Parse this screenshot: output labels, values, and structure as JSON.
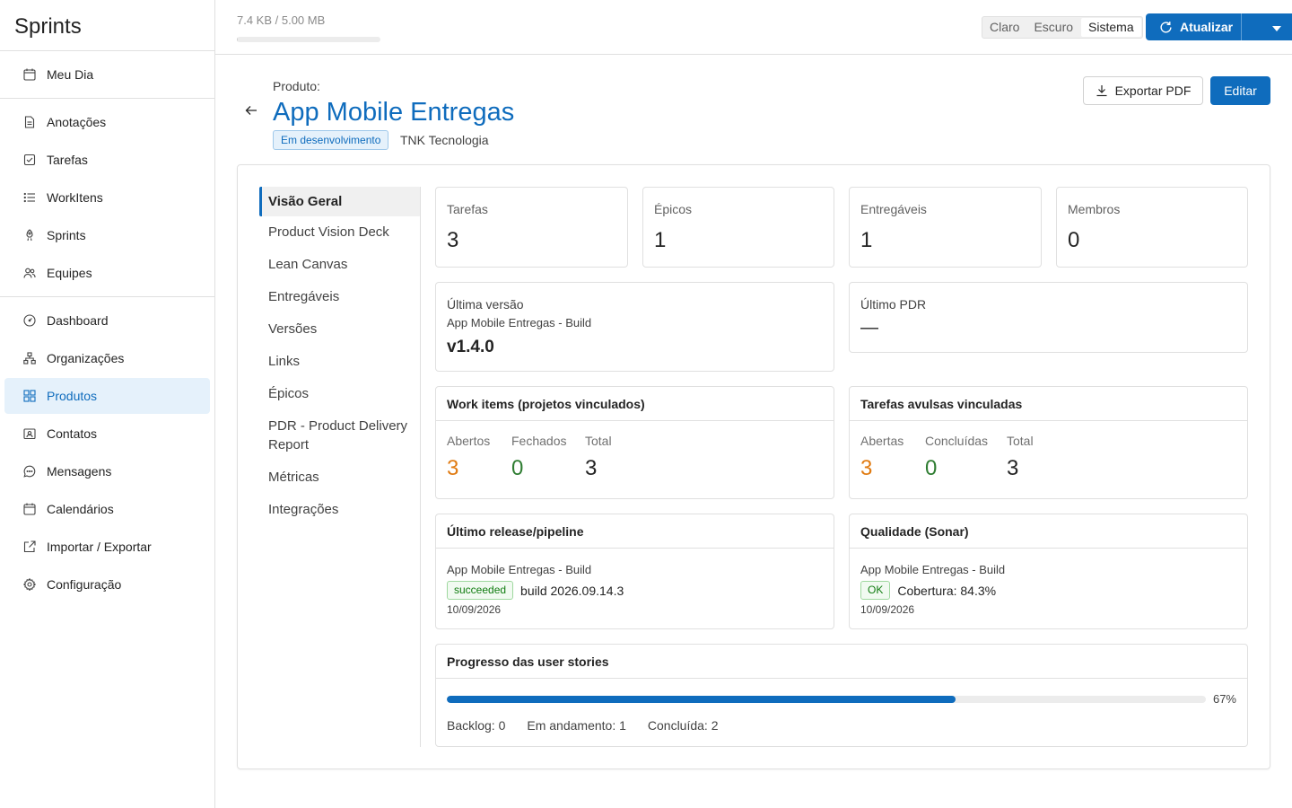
{
  "app": {
    "title": "Sprints"
  },
  "sidebar": {
    "groups": [
      [
        {
          "label": "Meu Dia",
          "icon": "calendar-icon"
        }
      ],
      [
        {
          "label": "Anotações",
          "icon": "note-icon"
        },
        {
          "label": "Tarefas",
          "icon": "checkbox-icon"
        },
        {
          "label": "WorkItens",
          "icon": "list-icon"
        },
        {
          "label": "Sprints",
          "icon": "rocket-icon"
        },
        {
          "label": "Equipes",
          "icon": "people-icon"
        }
      ],
      [
        {
          "label": "Dashboard",
          "icon": "gauge-icon"
        },
        {
          "label": "Organizações",
          "icon": "org-icon"
        },
        {
          "label": "Produtos",
          "icon": "grid-icon",
          "active": true
        },
        {
          "label": "Contatos",
          "icon": "contact-card-icon"
        },
        {
          "label": "Mensagens",
          "icon": "chat-icon"
        },
        {
          "label": "Calendários",
          "icon": "calendar-icon"
        },
        {
          "label": "Importar / Exportar",
          "icon": "share-icon"
        },
        {
          "label": "Configuração",
          "icon": "gear-icon"
        }
      ]
    ]
  },
  "topbar": {
    "storage_text": "7.4 KB / 5.00 MB",
    "storage_fraction": 0.0015,
    "theme_options": [
      "Claro",
      "Escuro",
      "Sistema"
    ],
    "theme_selected": "Sistema",
    "refresh_label": "Atualizar"
  },
  "header": {
    "label": "Produto:",
    "title": "App Mobile Entregas",
    "status": "Em desenvolvimento",
    "organization": "TNK Tecnologia",
    "export_label": "Exportar PDF",
    "edit_label": "Editar"
  },
  "tabs": [
    "Visão Geral",
    "Product Vision Deck",
    "Lean Canvas",
    "Entregáveis",
    "Versões",
    "Links",
    "Épicos",
    "PDR - Product Delivery Report",
    "Métricas",
    "Integrações"
  ],
  "active_tab": "Visão Geral",
  "stats": [
    {
      "label": "Tarefas",
      "value": "3"
    },
    {
      "label": "Épicos",
      "value": "1"
    },
    {
      "label": "Entregáveis",
      "value": "1"
    },
    {
      "label": "Membros",
      "value": "0"
    }
  ],
  "last_version": {
    "label": "Última versão",
    "subtitle": "App Mobile Entregas - Build",
    "value": "v1.4.0"
  },
  "last_pdr": {
    "label": "Último PDR",
    "value": "—"
  },
  "work_items": {
    "title": "Work items (projetos vinculados)",
    "open_label": "Abertos",
    "open": "3",
    "closed_label": "Fechados",
    "closed": "0",
    "total_label": "Total",
    "total": "3"
  },
  "loose_tasks": {
    "title": "Tarefas avulsas vinculadas",
    "open_label": "Abertas",
    "open": "3",
    "done_label": "Concluídas",
    "done": "0",
    "total_label": "Total",
    "total": "3"
  },
  "release": {
    "title": "Último release/pipeline",
    "pipeline": "App Mobile Entregas - Build",
    "status": "succeeded",
    "build": "build 2026.09.14.3",
    "date": "10/09/2026"
  },
  "quality": {
    "title": "Qualidade (Sonar)",
    "project": "App Mobile Entregas - Build",
    "status": "OK",
    "coverage": "Cobertura: 84.3%",
    "date": "10/09/2026"
  },
  "stories": {
    "title": "Progresso das user stories",
    "percent": 67,
    "percent_text": "67%",
    "backlog": "Backlog: 0",
    "in_progress": "Em andamento: 1",
    "done": "Concluída: 2"
  }
}
